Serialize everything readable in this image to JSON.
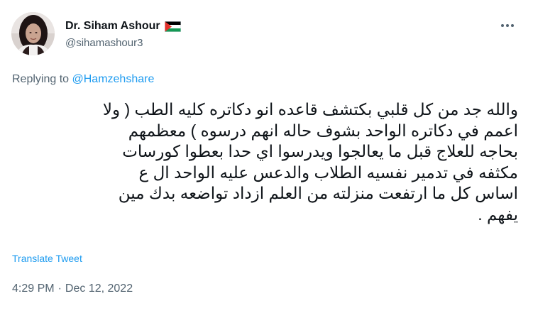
{
  "author": {
    "display_name": "Dr. Siham Ashour",
    "handle": "@sihamashour3",
    "flag_icon": "palestine-flag-icon",
    "avatar_icon": "profile-photo-avatar"
  },
  "more_icon": "more-dots-icon",
  "reply": {
    "prefix": "Replying to",
    "mention": "@Hamzehshare"
  },
  "body": {
    "lines": [
      "والله جد من كل قلبي بكتشف قاعده انو دكاتره كليه الطب ( ولا",
      "اعمم في دكاتره الواحد بشوف حاله انهم درسوه ) معظمهم",
      "بحاجه للعلاج قبل ما يعالجوا ويدرسوا اي حدا بعطوا كورسات",
      "مكثفه في تدمير نفسيه الطلاب والدعس عليه الواحد ال ع",
      "اساس كل ما ارتفعت منزلته من العلم ازداد تواضعه بدك مين",
      "يفهم ."
    ]
  },
  "translate_label": "Translate Tweet",
  "meta": {
    "time": "4:29 PM",
    "separator": "·",
    "date": "Dec 12, 2022"
  },
  "colors": {
    "text_primary": "#0f1419",
    "text_secondary": "#536471",
    "link": "#1d9bf0",
    "flag_black": "#000000",
    "flag_green": "#149954",
    "flag_red": "#e4312b"
  }
}
